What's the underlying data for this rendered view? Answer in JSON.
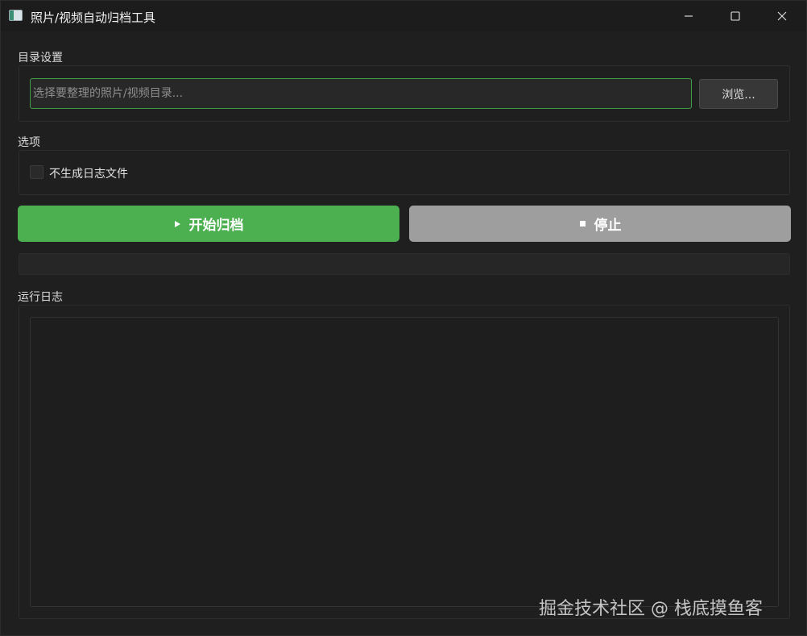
{
  "window": {
    "title": "照片/视频自动归档工具"
  },
  "directory_section": {
    "label": "目录设置",
    "input_value": "",
    "input_placeholder": "选择要整理的照片/视频目录...",
    "browse_label": "浏览..."
  },
  "options_section": {
    "label": "选项",
    "no_log_file_label": "不生成日志文件",
    "no_log_file_checked": false
  },
  "actions": {
    "start_label": "开始归档",
    "start_icon": "play-icon",
    "stop_label": "停止",
    "stop_icon": "stop-square-icon"
  },
  "progress": {
    "value": 0
  },
  "log_section": {
    "label": "运行日志",
    "content": ""
  },
  "watermark": {
    "text": "掘金技术社区 @ 栈底摸鱼客"
  },
  "colors": {
    "start_button": "#4caf50",
    "stop_button": "#9e9e9e",
    "input_focus_border": "#3f9d48",
    "background": "#1f1f1f"
  }
}
